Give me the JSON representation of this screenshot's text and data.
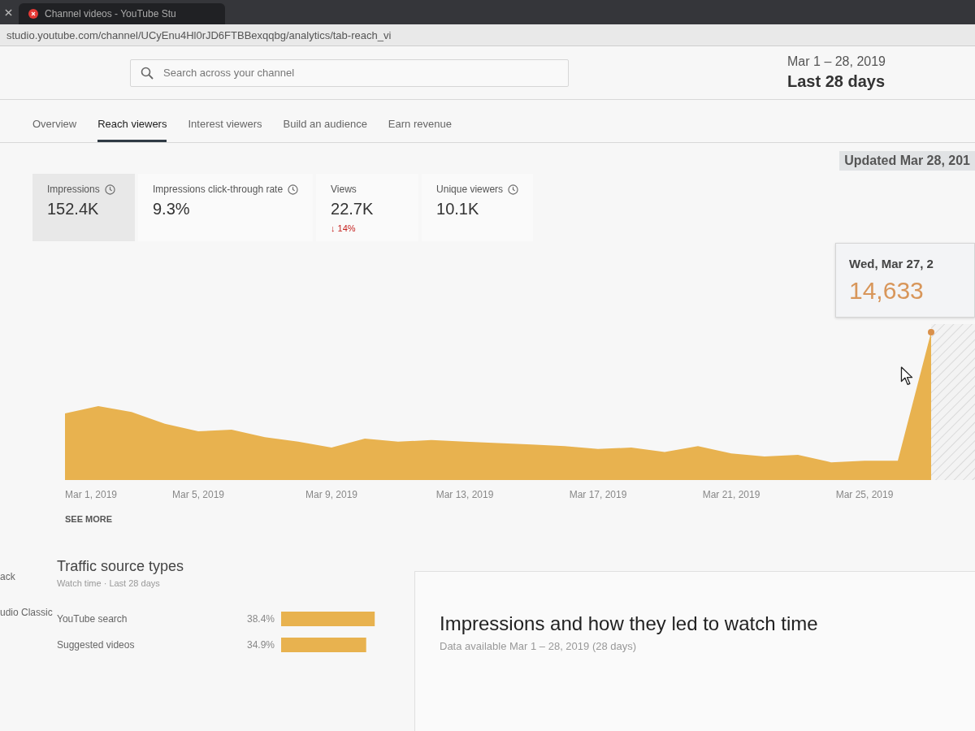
{
  "browser": {
    "tab": {
      "title": "Channel videos - YouTube Stu"
    },
    "address": "studio.youtube.com/channel/UCyEnu4Hl0rJD6FTBBexqqbg/analytics/tab-reach_vi"
  },
  "search": {
    "placeholder": "Search across your channel"
  },
  "date_range": {
    "range": "Mar 1 – 28, 2019",
    "label": "Last 28 days"
  },
  "tabs": [
    {
      "label": "Overview",
      "selected": false
    },
    {
      "label": "Reach viewers",
      "selected": true
    },
    {
      "label": "Interest viewers",
      "selected": false
    },
    {
      "label": "Build an audience",
      "selected": false
    },
    {
      "label": "Earn revenue",
      "selected": false
    }
  ],
  "updated": "Updated Mar 28, 201",
  "metrics": [
    {
      "label": "Impressions",
      "value": "152.4K",
      "clock": true,
      "selected": true
    },
    {
      "label": "Impressions click-through rate",
      "value": "9.3%",
      "clock": true,
      "selected": false
    },
    {
      "label": "Views",
      "value": "22.7K",
      "clock": false,
      "selected": false,
      "change": {
        "text": "↓ 14%",
        "negative": true
      }
    },
    {
      "label": "Unique viewers",
      "value": "10.1K",
      "clock": true,
      "selected": false
    }
  ],
  "chart": {
    "x_labels": [
      "Mar 1, 2019",
      "Mar 5, 2019",
      "Mar 9, 2019",
      "Mar 13, 2019",
      "Mar 17, 2019",
      "Mar 21, 2019",
      "Mar 25, 2019"
    ],
    "tooltip": {
      "date": "Wed, Mar 27, 2",
      "value": "14,633"
    }
  },
  "see_more": "SEE MORE",
  "sidebar": {
    "items": [
      {
        "label": "ack"
      },
      {
        "label": "udio Classic"
      }
    ]
  },
  "traffic_sources": {
    "title": "Traffic source types",
    "subtitle": "Watch time · Last 28 days",
    "chart_data": [
      {
        "type": "bar",
        "orientation": "horizontal",
        "categories": [
          "YouTube search",
          "Suggested videos"
        ],
        "values": [
          38.4,
          34.9
        ],
        "color": "#e8b24f",
        "value_labels": [
          "38.4%",
          "34.9%"
        ]
      }
    ]
  },
  "impressions_card": {
    "title": "Impressions and how they led to watch time",
    "subtitle": "Data available Mar 1 – 28, 2019 (28 days)"
  }
}
